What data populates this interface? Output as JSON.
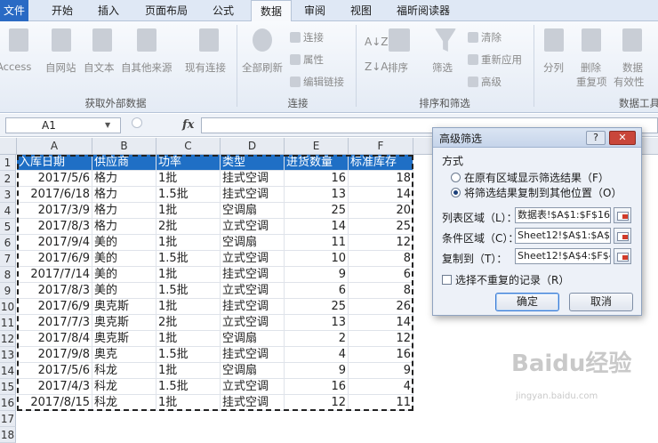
{
  "tabs": [
    "文件",
    "开始",
    "插入",
    "页面布局",
    "公式",
    "数据",
    "审阅",
    "视图",
    "福昕阅读器"
  ],
  "ribbon": {
    "external": {
      "buttons": [
        "Access",
        "自网站",
        "自文本",
        "自其他来源",
        "现有连接"
      ],
      "group_label": "获取外部数据"
    },
    "connections": {
      "refresh_all": "全部刷新",
      "small": [
        "连接",
        "属性",
        "编辑链接"
      ],
      "group_label": "连接"
    },
    "sort_filter": {
      "sort": "排序",
      "filter": "筛选",
      "small": [
        "清除",
        "重新应用",
        "高级"
      ],
      "group_label": "排序和筛选"
    },
    "data_tools": {
      "split": "分列",
      "remove_dup": [
        "删除",
        "重复项"
      ],
      "validation": [
        "数据",
        "有效性"
      ],
      "group_label": "数据工具"
    }
  },
  "formula_bar": {
    "name_box": "A1",
    "fx": "fx",
    "value": ""
  },
  "columns": [
    "A",
    "B",
    "C",
    "D",
    "E",
    "F"
  ],
  "row_numbers": [
    "1",
    "2",
    "3",
    "4",
    "5",
    "6",
    "7",
    "8",
    "9",
    "10",
    "11",
    "12",
    "13",
    "14",
    "15",
    "16",
    "17",
    "18"
  ],
  "table": {
    "headers": [
      "入库日期",
      "供应商",
      "功率",
      "类型",
      "进货数量",
      "标准库存"
    ],
    "rows": [
      [
        "2017/5/6",
        "格力",
        "1批",
        "挂式空调",
        "16",
        "18"
      ],
      [
        "2017/6/18",
        "格力",
        "1.5批",
        "挂式空调",
        "13",
        "14"
      ],
      [
        "2017/3/9",
        "格力",
        "1批",
        "空调扇",
        "25",
        "20"
      ],
      [
        "2017/8/3",
        "格力",
        "2批",
        "立式空调",
        "14",
        "25"
      ],
      [
        "2017/9/4",
        "美的",
        "1批",
        "空调扇",
        "11",
        "12"
      ],
      [
        "2017/6/9",
        "美的",
        "1.5批",
        "立式空调",
        "10",
        "8"
      ],
      [
        "2017/7/14",
        "美的",
        "1批",
        "挂式空调",
        "9",
        "6"
      ],
      [
        "2017/8/3",
        "美的",
        "1.5批",
        "立式空调",
        "6",
        "8"
      ],
      [
        "2017/6/9",
        "奥克斯",
        "1批",
        "挂式空调",
        "25",
        "26"
      ],
      [
        "2017/7/3",
        "奥克斯",
        "2批",
        "立式空调",
        "13",
        "14"
      ],
      [
        "2017/8/4",
        "奥克斯",
        "1批",
        "空调扇",
        "2",
        "12"
      ],
      [
        "2017/9/8",
        "奥克",
        "1.5批",
        "挂式空调",
        "4",
        "16"
      ],
      [
        "2017/5/6",
        "科龙",
        "1批",
        "空调扇",
        "9",
        "9"
      ],
      [
        "2017/4/3",
        "科龙",
        "1.5批",
        "立式空调",
        "16",
        "4"
      ],
      [
        "2017/8/15",
        "科龙",
        "1批",
        "挂式空调",
        "12",
        "11"
      ]
    ]
  },
  "dialog": {
    "title": "高级筛选",
    "help": "?",
    "close": "✕",
    "method_label": "方式",
    "option1": "在原有区域显示筛选结果（F）",
    "option2": "将筛选结果复制到其他位置（O）",
    "list_range_label": "列表区域（L）：",
    "list_range_value": "数据表!$A$1:$F$16",
    "criteria_label": "条件区域（C）：",
    "criteria_value": "Sheet12!$A$1:$A$2",
    "copy_to_label": "复制到（T）：",
    "copy_to_value": "Sheet12!$A$4:$F$4",
    "unique_label": "选择不重复的记录（R）",
    "ok": "确定",
    "cancel": "取消"
  },
  "watermark": {
    "brand": "Baidu经验",
    "url": "jingyan.baidu.com"
  }
}
